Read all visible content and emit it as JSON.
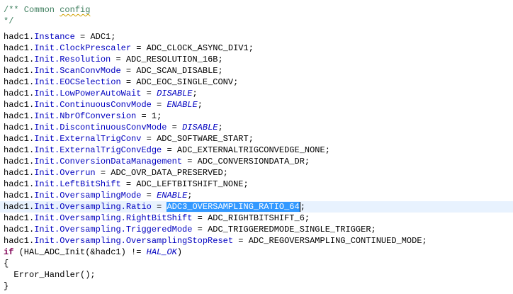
{
  "code": {
    "comment_open": "/** Common ",
    "comment_word": "config",
    "comment_close": "*/",
    "obj": "hadc1.",
    "lines": [
      {
        "field": "Instance",
        "op": " = ",
        "value": "ADC1",
        "italic": false,
        "end": ";"
      },
      {
        "field": "Init.ClockPrescaler",
        "op": " = ",
        "value": "ADC_CLOCK_ASYNC_DIV1",
        "italic": false,
        "end": ";"
      },
      {
        "field": "Init.Resolution",
        "op": " = ",
        "value": "ADC_RESOLUTION_16B",
        "italic": false,
        "end": ";"
      },
      {
        "field": "Init.ScanConvMode",
        "op": " = ",
        "value": "ADC_SCAN_DISABLE",
        "italic": false,
        "end": ";"
      },
      {
        "field": "Init.EOCSelection",
        "op": " = ",
        "value": "ADC_EOC_SINGLE_CONV",
        "italic": false,
        "end": ";"
      },
      {
        "field": "Init.LowPowerAutoWait",
        "op": " = ",
        "value": "DISABLE",
        "italic": true,
        "end": ";"
      },
      {
        "field": "Init.ContinuousConvMode",
        "op": " = ",
        "value": "ENABLE",
        "italic": true,
        "end": ";"
      },
      {
        "field": "Init.NbrOfConversion",
        "op": " = ",
        "value": "1",
        "italic": false,
        "end": ";"
      },
      {
        "field": "Init.DiscontinuousConvMode",
        "op": " = ",
        "value": "DISABLE",
        "italic": true,
        "end": ";"
      },
      {
        "field": "Init.ExternalTrigConv",
        "op": " = ",
        "value": "ADC_SOFTWARE_START",
        "italic": false,
        "end": ";"
      },
      {
        "field": "Init.ExternalTrigConvEdge",
        "op": " = ",
        "value": "ADC_EXTERNALTRIGCONVEDGE_NONE",
        "italic": false,
        "end": ";"
      },
      {
        "field": "Init.ConversionDataManagement",
        "op": " = ",
        "value": "ADC_CONVERSIONDATA_DR",
        "italic": false,
        "end": ";"
      },
      {
        "field": "Init.Overrun",
        "op": " = ",
        "value": "ADC_OVR_DATA_PRESERVED",
        "italic": false,
        "end": ";"
      },
      {
        "field": "Init.LeftBitShift",
        "op": " = ",
        "value": "ADC_LEFTBITSHIFT_NONE",
        "italic": false,
        "end": ";"
      },
      {
        "field": "Init.OversamplingMode",
        "op": " = ",
        "value": "ENABLE",
        "italic": true,
        "end": ";"
      },
      {
        "field": "Init.Oversampling.Ratio",
        "op": " = ",
        "value": "ADC3_OVERSAMPLING_RATIO_64",
        "italic": false,
        "end": ";",
        "selected": true
      },
      {
        "field": "Init.Oversampling.RightBitShift",
        "op": " = ",
        "value": "ADC_RIGHTBITSHIFT_6",
        "italic": false,
        "end": ";"
      },
      {
        "field": "Init.Oversampling.TriggeredMode",
        "op": " = ",
        "value": "ADC_TRIGGEREDMODE_SINGLE_TRIGGER",
        "italic": false,
        "end": ";"
      },
      {
        "field": "Init.Oversampling.OversamplingStopReset",
        "op": " = ",
        "value": "ADC_REGOVERSAMPLING_CONTINUED_MODE",
        "italic": false,
        "end": ";"
      }
    ],
    "if_keyword": "if",
    "if_open": " (HAL_ADC_Init(&hadc1) != ",
    "if_value": "HAL_OK",
    "if_close": ")",
    "brace_open": "{",
    "error_call": "  Error_Handler();",
    "brace_close": "}"
  }
}
